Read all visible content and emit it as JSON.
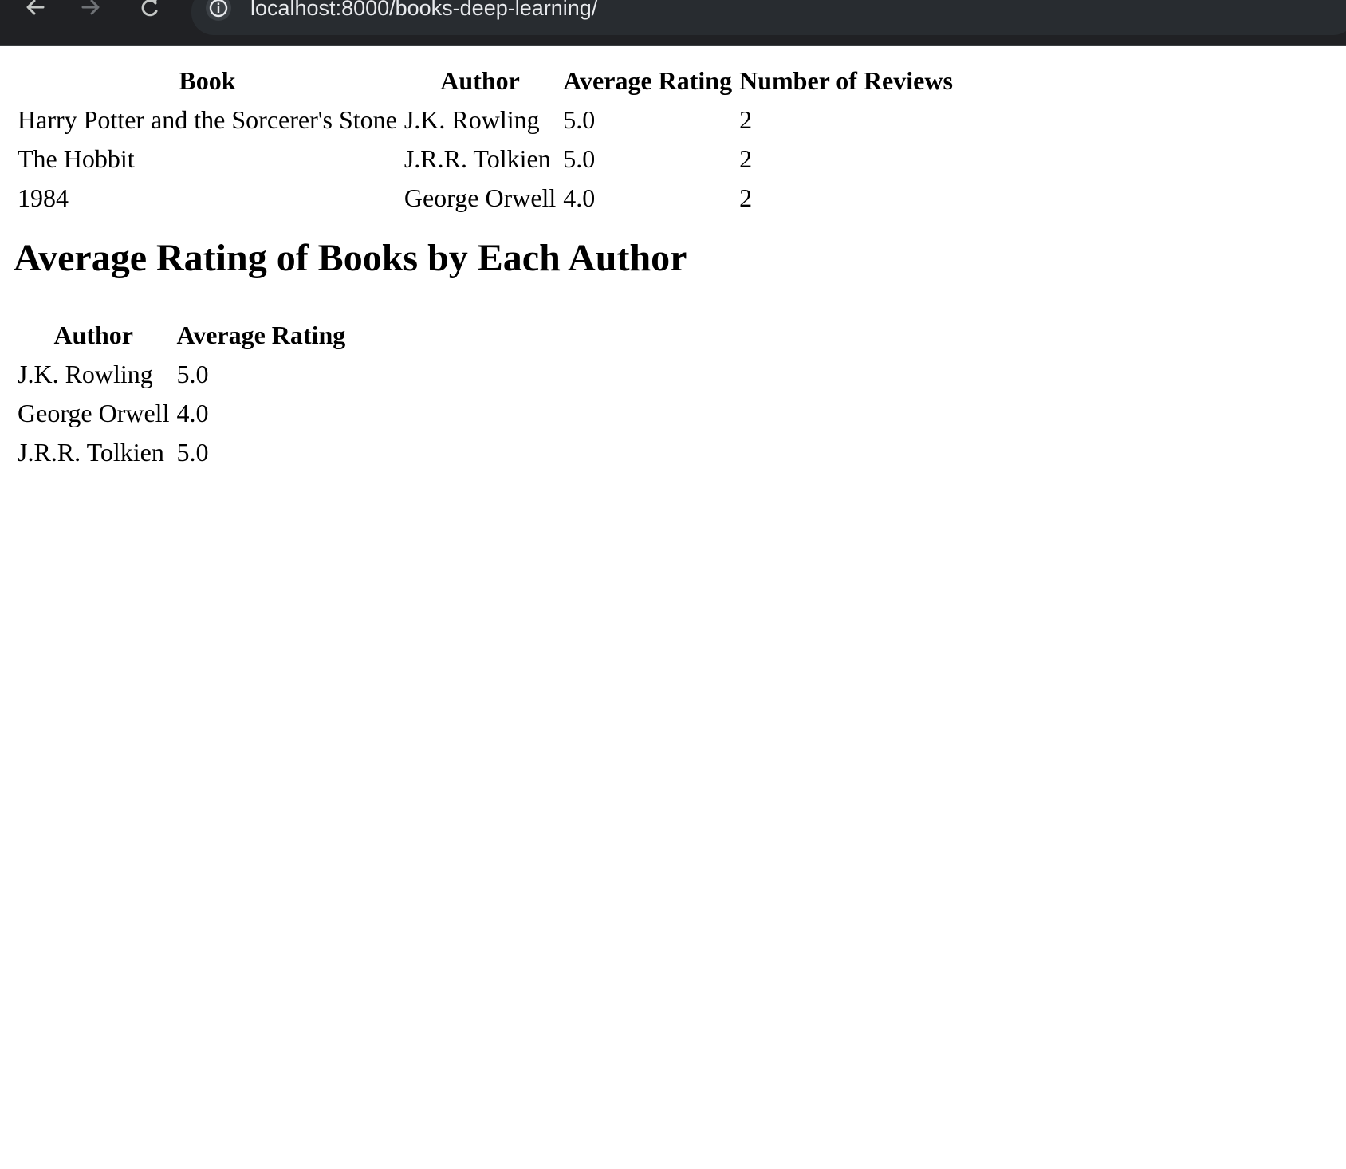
{
  "browser": {
    "url": "localhost:8000/books-deep-learning/",
    "icons": {
      "back": "arrow-left-icon",
      "forward": "arrow-right-icon",
      "reload": "reload-icon",
      "site_info": "info-icon"
    }
  },
  "books_table": {
    "headers": [
      "Book",
      "Author",
      "Average Rating",
      "Number of Reviews"
    ],
    "rows": [
      [
        "Harry Potter and the Sorcerer's Stone",
        "J.K. Rowling",
        "5.0",
        "2"
      ],
      [
        "The Hobbit",
        "J.R.R. Tolkien",
        "5.0",
        "2"
      ],
      [
        "1984",
        "George Orwell",
        "4.0",
        "2"
      ]
    ]
  },
  "section_heading": "Average Rating of Books by Each Author",
  "authors_table": {
    "headers": [
      "Author",
      "Average Rating"
    ],
    "rows": [
      [
        "J.K. Rowling",
        "5.0"
      ],
      [
        "George Orwell",
        "4.0"
      ],
      [
        "J.R.R. Tolkien",
        "5.0"
      ]
    ]
  }
}
